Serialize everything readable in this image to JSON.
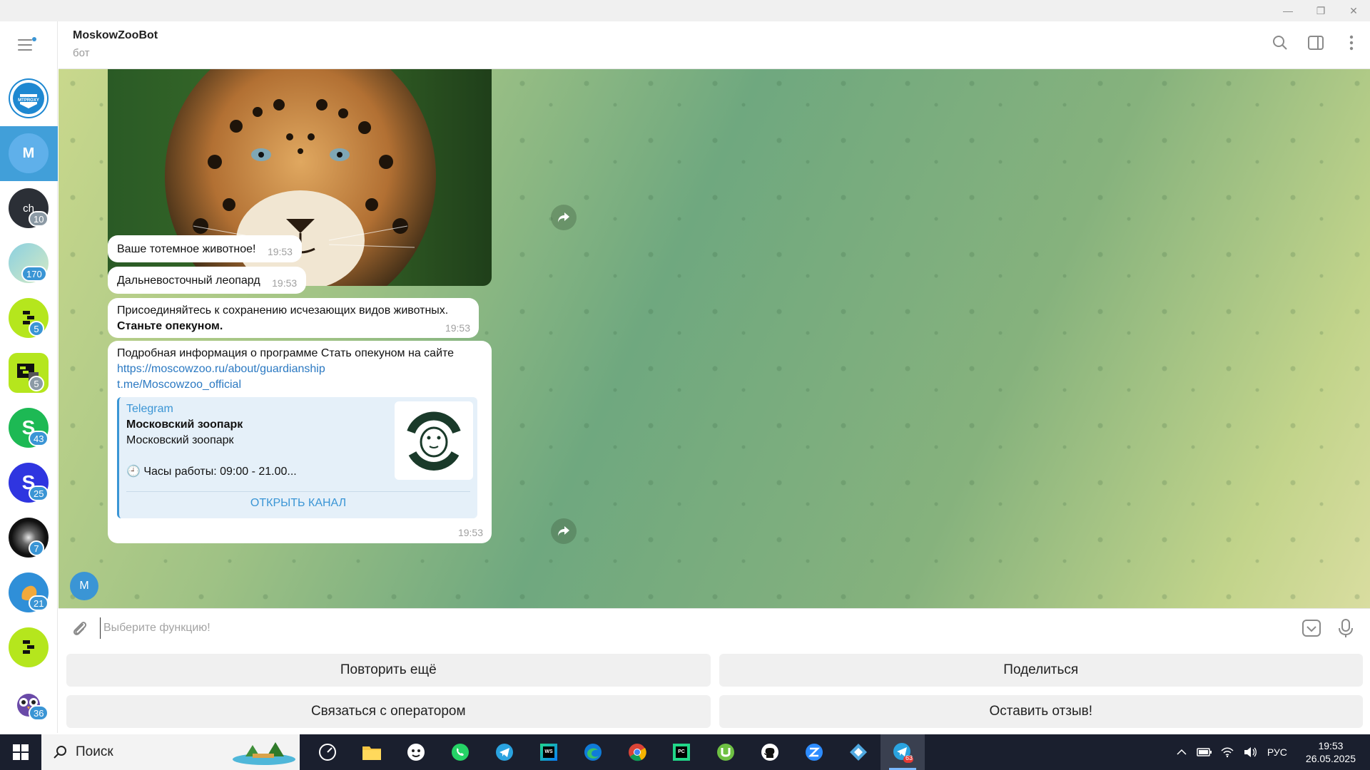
{
  "window": {
    "controls": [
      "—",
      "❐",
      "✕"
    ]
  },
  "sidebar": {
    "chats": [
      {
        "name": "MTPROXY",
        "initial": "",
        "color": "#1e88d1",
        "badge": ""
      },
      {
        "name": "MoskowZooBot",
        "initial": "M",
        "color": "#3a95d5",
        "badge": "",
        "active": true
      },
      {
        "name": "ch",
        "initial": "ch",
        "color": "#2b2f36",
        "badge": "10"
      },
      {
        "name": "channel",
        "initial": "",
        "color": "#86c7d8",
        "badge": "170"
      },
      {
        "name": "app-green-1",
        "initial": "",
        "color": "#b5e61d",
        "badge": "5"
      },
      {
        "name": "app-green-2",
        "initial": "",
        "color": "#b5e61d",
        "badge": "5"
      },
      {
        "name": "S-green",
        "initial": "S",
        "color": "#1db954",
        "badge": "43"
      },
      {
        "name": "S-blue",
        "initial": "S",
        "color": "#2f35e0",
        "badge": "25"
      },
      {
        "name": "galaxy",
        "initial": "",
        "color": "#1b1b1b",
        "badge": "7"
      },
      {
        "name": "hand",
        "initial": "",
        "color": "#2f8fd8",
        "badge": "21"
      },
      {
        "name": "app-green-3",
        "initial": "",
        "color": "#b5e61d",
        "badge": ""
      },
      {
        "name": "owl",
        "initial": "",
        "color": "#ffffff",
        "badge": "36"
      }
    ]
  },
  "header": {
    "title": "MoskowZooBot",
    "subtitle": "бот"
  },
  "messages": {
    "msg1": {
      "text": "Ваше тотемное животное!",
      "time": "19:53"
    },
    "msg2": {
      "text": "Дальневосточный леопард",
      "time": "19:53"
    },
    "msg3": {
      "line1": "Присоединяйтесь к сохранению исчезающих видов животных.",
      "line2": "Станьте опекуном.",
      "time": "19:53"
    },
    "msg4": {
      "text": "Подробная информация о программе Стать опекуном на сайте",
      "link1": "https://moscowzoo.ru/about/guardianship",
      "link2": "t.me/Moscowzoo_official",
      "preview_site": "Telegram",
      "preview_title": "Московский зоопарк",
      "preview_desc": "Московский зоопарк",
      "preview_hours": "🕘 Часы работы: 09:00 - 21.00...",
      "preview_button": "Открыть канал",
      "time": "19:53"
    },
    "sender_initial": "M"
  },
  "composer": {
    "placeholder": "Выберите функцию!"
  },
  "keyboard": {
    "row1": [
      "Повторить ещё",
      "Поделиться"
    ],
    "row2": [
      "Связаться с оператором",
      "Оставить отзыв!"
    ]
  },
  "taskbar": {
    "search_label": "Поиск",
    "lang": "РУС",
    "time": "19:53",
    "date": "26.05.2025",
    "telegram_badge": "63"
  },
  "colors": {
    "accent": "#3a95d5",
    "link": "#2b79c2"
  }
}
